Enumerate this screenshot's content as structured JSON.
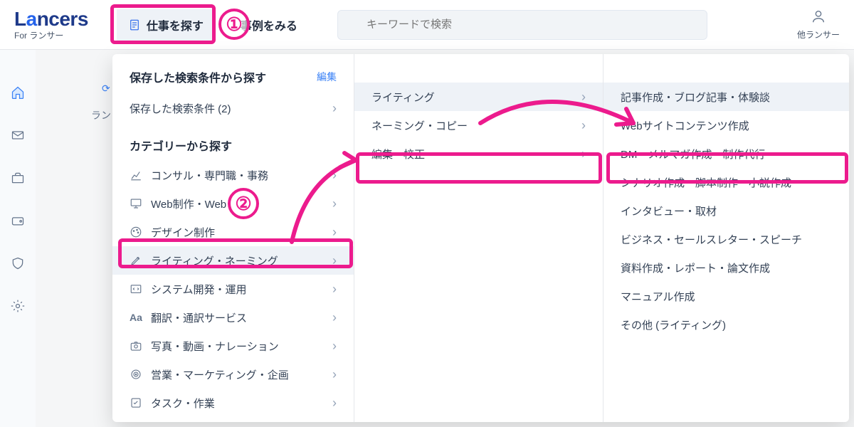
{
  "logo_main": "Lancers",
  "logo_sub": "For ランサー",
  "nav": {
    "find_work": "仕事を探す",
    "cases": "事例をみる"
  },
  "search_placeholder": "キーワードで検索",
  "right_label": "他ランサー",
  "crumb": {
    "refresh": "⟳",
    "text": "ラン"
  },
  "mega": {
    "saved_title": "保存した検索条件から探す",
    "edit": "編集",
    "saved_item": "保存した検索条件 (2)",
    "cat_title": "カテゴリーから探す",
    "cats": [
      "コンサル・専門職・事務",
      "Web制作・Web",
      "デザイン制作",
      "ライティング・ネーミング",
      "システム開発・運用",
      "翻訳・通訳サービス",
      "写真・動画・ナレーション",
      "営業・マーケティング・企画",
      "タスク・作業"
    ],
    "col2": [
      "ライティング",
      "ネーミング・コピー",
      "編集・校正"
    ],
    "col3": [
      "記事作成・ブログ記事・体験談",
      "Webサイトコンテンツ作成",
      "DM・メルマガ作成・制作代行",
      "シナリオ作成・脚本制作・小説作成",
      "インタビュー・取材",
      "ビジネス・セールスレター・スピーチ",
      "資料作成・レポート・論文作成",
      "マニュアル作成",
      "その他 (ライティング)"
    ]
  },
  "annot": {
    "one": "①",
    "two": "②"
  }
}
